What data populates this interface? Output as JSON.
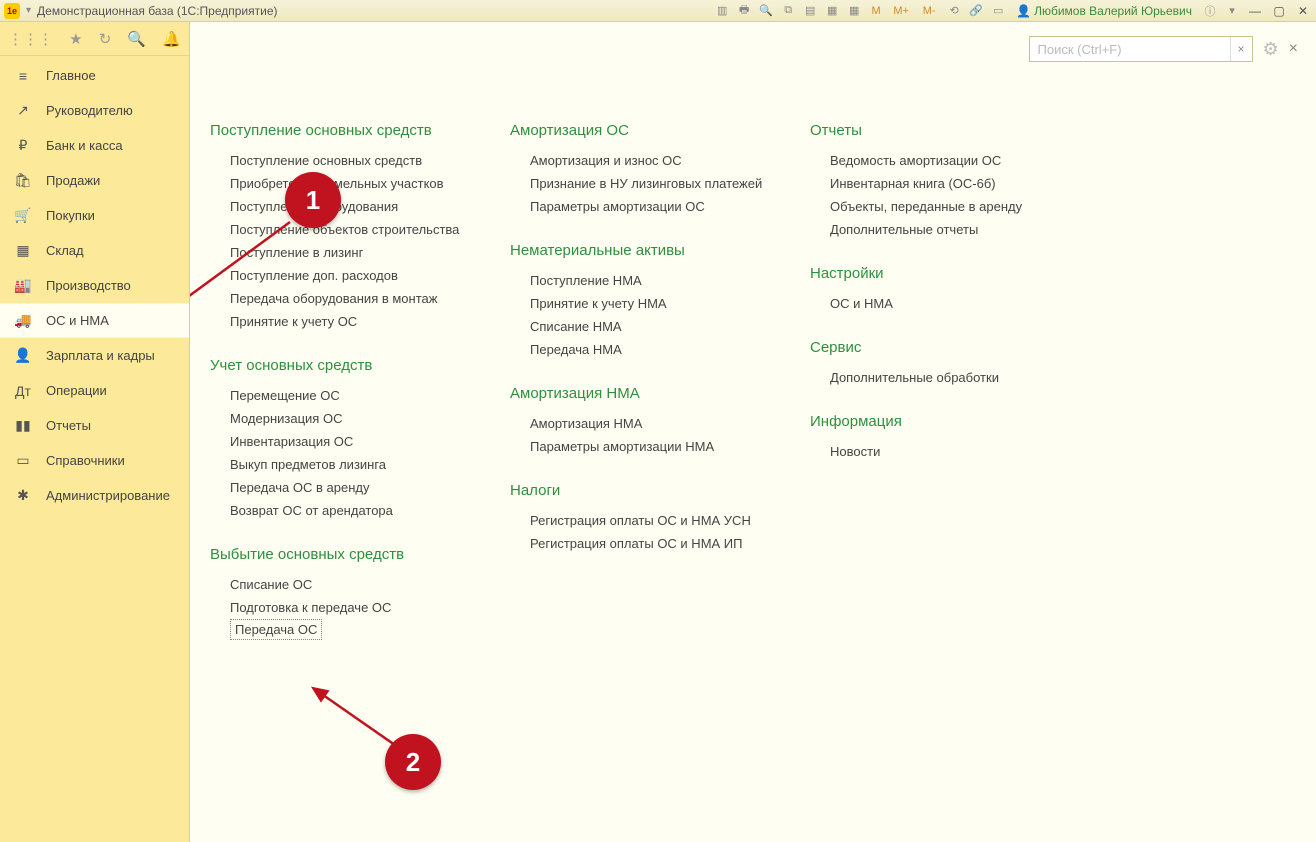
{
  "title": "Демонстрационная база  (1С:Предприятие)",
  "user": "Любимов Валерий Юрьевич",
  "toolbar_letters": [
    "M",
    "M+",
    "M-"
  ],
  "search": {
    "placeholder": "Поиск (Ctrl+F)"
  },
  "sidebar": {
    "items": [
      {
        "icon": "≡",
        "label": "Главное"
      },
      {
        "icon": "↗",
        "label": "Руководителю"
      },
      {
        "icon": "₽",
        "label": "Банк и касса"
      },
      {
        "icon": "🛍",
        "label": "Продажи"
      },
      {
        "icon": "🛒",
        "label": "Покупки"
      },
      {
        "icon": "▦",
        "label": "Склад"
      },
      {
        "icon": "🏭",
        "label": "Производство"
      },
      {
        "icon": "🚚",
        "label": "ОС и НМА"
      },
      {
        "icon": "👤",
        "label": "Зарплата и кадры"
      },
      {
        "icon": "Дт",
        "label": "Операции"
      },
      {
        "icon": "▮▮",
        "label": "Отчеты"
      },
      {
        "icon": "▭",
        "label": "Справочники"
      },
      {
        "icon": "✱",
        "label": "Администрирование"
      }
    ],
    "active_index": 7
  },
  "columns": [
    [
      {
        "title": "Поступление основных средств",
        "items": [
          "Поступление основных средств",
          "Приобретение земельных участков",
          "Поступление оборудования",
          "Поступление объектов строительства",
          "Поступление в лизинг",
          "Поступление доп. расходов",
          "Передача оборудования в монтаж",
          "Принятие к учету ОС"
        ]
      },
      {
        "title": "Учет основных средств",
        "items": [
          "Перемещение ОС",
          "Модернизация ОС",
          "Инвентаризация ОС",
          "Выкуп предметов лизинга",
          "Передача ОС в аренду",
          "Возврат ОС от арендатора"
        ]
      },
      {
        "title": "Выбытие основных средств",
        "items": [
          "Списание ОС",
          "Подготовка к передаче ОС",
          "Передача ОС"
        ]
      }
    ],
    [
      {
        "title": "Амортизация ОС",
        "items": [
          "Амортизация и износ ОС",
          "Признание в НУ лизинговых платежей",
          "Параметры амортизации ОС"
        ]
      },
      {
        "title": "Нематериальные активы",
        "items": [
          "Поступление НМА",
          "Принятие к учету НМА",
          "Списание НМА",
          "Передача НМА"
        ]
      },
      {
        "title": "Амортизация НМА",
        "items": [
          "Амортизация НМА",
          "Параметры амортизации НМА"
        ]
      },
      {
        "title": "Налоги",
        "items": [
          "Регистрация оплаты ОС и НМА УСН",
          "Регистрация оплаты ОС и НМА ИП"
        ]
      }
    ],
    [
      {
        "title": "Отчеты",
        "items": [
          "Ведомость амортизации ОС",
          "Инвентарная книга (ОС-6б)",
          "Объекты, переданные в аренду",
          "Дополнительные отчеты"
        ]
      },
      {
        "title": "Настройки",
        "items": [
          "ОС и НМА"
        ]
      },
      {
        "title": "Сервис",
        "items": [
          "Дополнительные обработки"
        ]
      },
      {
        "title": "Информация",
        "items": [
          "Новости"
        ]
      }
    ]
  ],
  "annotations": {
    "badge1": "1",
    "badge2": "2"
  }
}
